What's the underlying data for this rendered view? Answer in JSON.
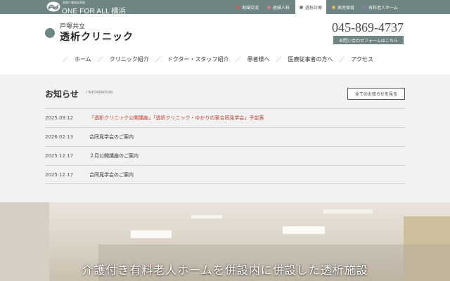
{
  "topbar": {
    "small_label": "医療介護福祉事業",
    "brand": "ONE FOR ALL 横浜",
    "links": [
      {
        "label": "地域交流",
        "dot": "#d9534f",
        "active": false
      },
      {
        "label": "産婦人科",
        "dot": "#e07a8a",
        "active": false
      },
      {
        "label": "透析診療",
        "dot": "#6f8583",
        "active": true
      },
      {
        "label": "病児保育",
        "dot": "#e8b84a",
        "active": false
      },
      {
        "label": "有料老人ホーム",
        "dot": "#8a7bb0",
        "active": false
      }
    ]
  },
  "header": {
    "subtitle": "戸塚共立",
    "site_name": "透析クリニック",
    "phone": "045-869-4737",
    "contact_label": "お問い合わせフォームはこちら"
  },
  "nav": {
    "items": [
      "ホーム",
      "クリニック紹介",
      "ドクター・スタッフ紹介",
      "患者様へ",
      "医療従事者の方へ",
      "アクセス"
    ]
  },
  "news": {
    "title": "お知らせ",
    "title_en": "/ INFORMATION",
    "all_label": "全てのお知らせを見る",
    "items": [
      {
        "date": "2025.09.12",
        "text": "「透析クリニック公開講座」「透析クリニック・ゆかりの里合同見学会」予定表",
        "highlight": true
      },
      {
        "date": "2026.02.13",
        "text": "合同見学会のご案内",
        "highlight": false
      },
      {
        "date": "2025.12.17",
        "text": "２月公開講座のご案内",
        "highlight": false
      },
      {
        "date": "2025.12.17",
        "text": "合同見学会のご案内",
        "highlight": false
      }
    ]
  },
  "hero": {
    "caption": "介護付き有料老人ホームを併設内に併設した透析施設"
  },
  "colors": {
    "brand": "#6f8583",
    "accent_red": "#c0392b"
  }
}
